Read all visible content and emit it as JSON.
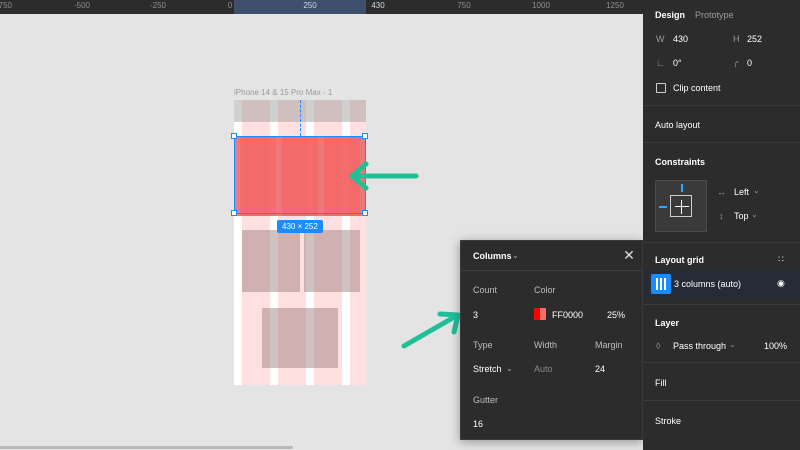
{
  "ruler": {
    "ticks": [
      "-750",
      "-500",
      "-250",
      "0",
      "250",
      "430",
      "750",
      "1000",
      "1250"
    ]
  },
  "canvas": {
    "frame_label": "iPhone 14 & 15 Pro Max - 1",
    "size_badge": "430 × 252",
    "accent_color": "#1a8cff",
    "arrow_color": "#1fbf98"
  },
  "popover": {
    "title": "Columns",
    "count_label": "Count",
    "count_value": "3",
    "color_label": "Color",
    "color_hex": "FF0000",
    "color_opacity": "25%",
    "type_label": "Type",
    "type_value": "Stretch",
    "width_label": "Width",
    "width_value": "Auto",
    "margin_label": "Margin",
    "margin_value": "24",
    "gutter_label": "Gutter",
    "gutter_value": "16"
  },
  "panel": {
    "tabs": [
      "Design",
      "Prototype"
    ],
    "w_label": "W",
    "w_value": "430",
    "h_label": "H",
    "h_value": "252",
    "rotation_value": "0°",
    "radius_value": "0",
    "clip_content": "Clip content",
    "auto_layout": "Auto layout",
    "constraints": "Constraints",
    "constraint_h": "Left",
    "constraint_v": "Top",
    "layout_grid": "Layout grid",
    "grid_item": "3 columns (auto)",
    "layer": "Layer",
    "blend_mode": "Pass through",
    "layer_opacity": "100%",
    "fill": "Fill",
    "stroke": "Stroke"
  }
}
